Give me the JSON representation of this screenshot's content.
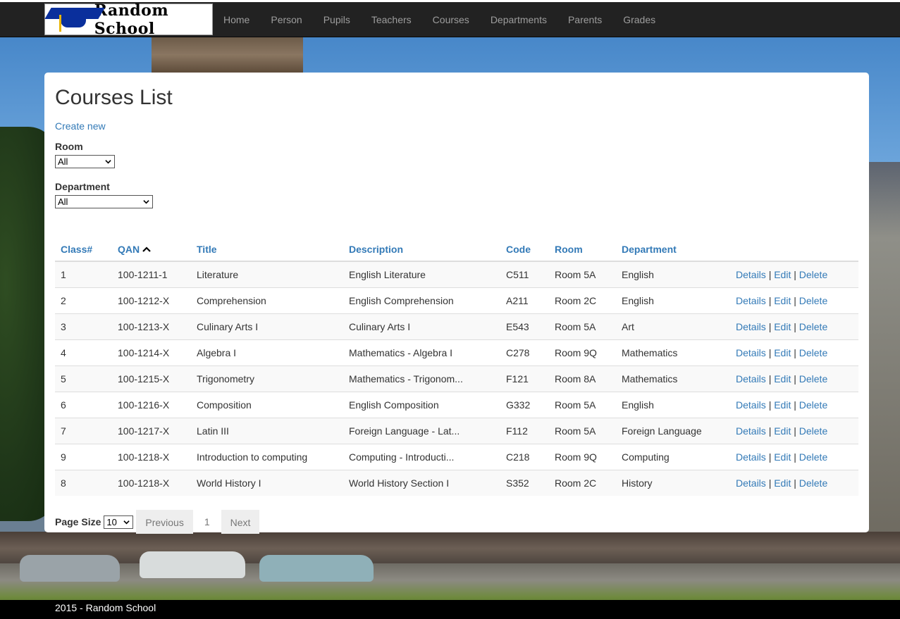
{
  "navbar": {
    "brand": "Random School",
    "items": [
      "Home",
      "Person",
      "Pupils",
      "Teachers",
      "Courses",
      "Departments",
      "Parents",
      "Grades"
    ]
  },
  "main": {
    "title": "Courses List",
    "create_label": "Create new",
    "filters": {
      "room_label": "Room",
      "room_value": "All",
      "department_label": "Department",
      "department_value": "All"
    },
    "table": {
      "headers": [
        "Class#",
        "QAN",
        "Title",
        "Description",
        "Code",
        "Room",
        "Department"
      ],
      "sort_column": "QAN",
      "sort_direction": "ascending",
      "action_labels": {
        "details": "Details",
        "edit": "Edit",
        "delete": "Delete",
        "separator": "|"
      },
      "rows": [
        [
          "1",
          "100-1211-1",
          "Literature",
          "English Literature",
          "C511",
          "Room 5A",
          "English"
        ],
        [
          "2",
          "100-1212-X",
          "Comprehension",
          "English Comprehension",
          "A211",
          "Room 2C",
          "English"
        ],
        [
          "3",
          "100-1213-X",
          "Culinary Arts I",
          "Culinary Arts I",
          "E543",
          "Room 5A",
          "Art"
        ],
        [
          "4",
          "100-1214-X",
          "Algebra I",
          "Mathematics - Algebra I",
          "C278",
          "Room 9Q",
          "Mathematics"
        ],
        [
          "5",
          "100-1215-X",
          "Trigonometry",
          "Mathematics - Trigonom...",
          "F121",
          "Room 8A",
          "Mathematics"
        ],
        [
          "6",
          "100-1216-X",
          "Composition",
          "English Composition",
          "G332",
          "Room 5A",
          "English"
        ],
        [
          "7",
          "100-1217-X",
          "Latin III",
          "Foreign Language - Lat...",
          "F112",
          "Room 5A",
          "Foreign Language"
        ],
        [
          "9",
          "100-1218-X",
          "Introduction to computing",
          "Computing - Introducti...",
          "C218",
          "Room 9Q",
          "Computing"
        ],
        [
          "8",
          "100-1218-X",
          "World History I",
          "World History Section I",
          "S352",
          "Room 2C",
          "History"
        ]
      ]
    },
    "pager": {
      "page_size_label": "Page Size",
      "page_size_value": "10",
      "previous_label": "Previous",
      "current_page": "1",
      "next_label": "Next"
    }
  },
  "footer": {
    "text": "2015 - Random School"
  },
  "colors": {
    "link": "#337ab7",
    "navbar": "#222222",
    "nav_text": "#9d9d9d"
  },
  "icons": {
    "brand_logo": "graduation-cap-icon",
    "sort": "chevron-up-icon",
    "dropdown": "chevron-down-icon"
  }
}
